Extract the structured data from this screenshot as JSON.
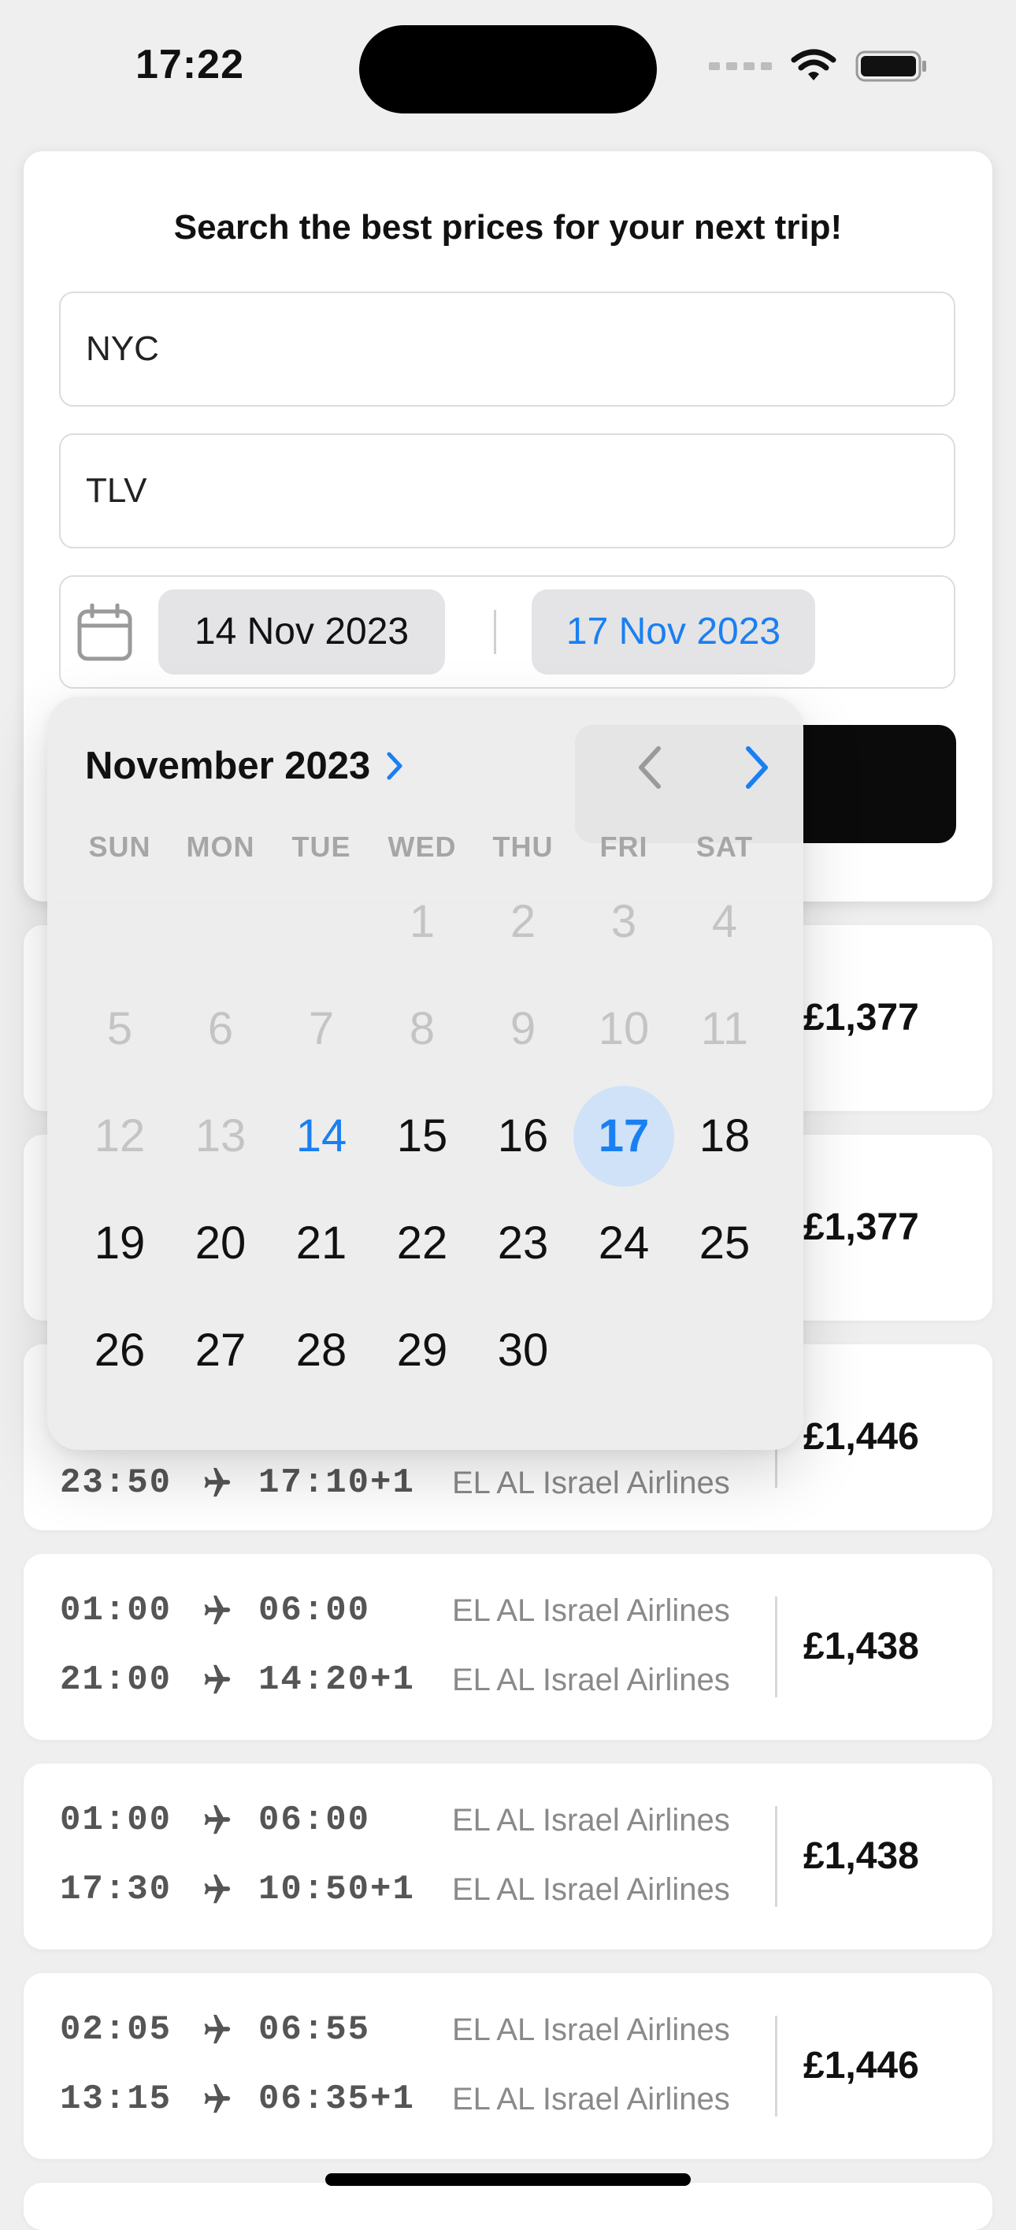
{
  "status_bar": {
    "time": "17:22"
  },
  "search": {
    "headline": "Search the best prices for your next trip!",
    "from_value": "NYC",
    "to_value": "TLV",
    "start_date": "14 Nov 2023",
    "end_date": "17 Nov 2023"
  },
  "calendar": {
    "month_label": "November 2023",
    "weekdays": [
      "SUN",
      "MON",
      "TUE",
      "WED",
      "THU",
      "FRI",
      "SAT"
    ],
    "disabled_days": [
      "1",
      "2",
      "3",
      "4",
      "5",
      "6",
      "7",
      "8",
      "9",
      "10",
      "11",
      "12",
      "13"
    ],
    "start_day": "14",
    "end_day": "17",
    "active_days": [
      "15",
      "16",
      "18",
      "19",
      "20",
      "21",
      "22",
      "23",
      "24",
      "25",
      "26",
      "27",
      "28",
      "29",
      "30"
    ],
    "accent_color": "#1a7ff2",
    "selection_fill": "#cfe2f8"
  },
  "results": [
    {
      "legs": [
        {
          "dep": "",
          "arr": "",
          "airline": ""
        },
        {
          "dep": "",
          "arr": "",
          "airline": ""
        }
      ],
      "price": "£1,377"
    },
    {
      "legs": [
        {
          "dep": "",
          "arr": "",
          "airline": ""
        },
        {
          "dep": "",
          "arr": "",
          "airline": ""
        }
      ],
      "price": "£1,377"
    },
    {
      "legs": [
        {
          "dep": "",
          "arr": "",
          "airline": ""
        },
        {
          "dep": "23:50",
          "arr": "17:10+1",
          "airline": "EL AL Israel Airlines"
        }
      ],
      "price": "£1,446"
    },
    {
      "legs": [
        {
          "dep": "01:00",
          "arr": "06:00",
          "airline": "EL AL Israel Airlines"
        },
        {
          "dep": "21:00",
          "arr": "14:20+1",
          "airline": "EL AL Israel Airlines"
        }
      ],
      "price": "£1,438"
    },
    {
      "legs": [
        {
          "dep": "01:00",
          "arr": "06:00",
          "airline": "EL AL Israel Airlines"
        },
        {
          "dep": "17:30",
          "arr": "10:50+1",
          "airline": "EL AL Israel Airlines"
        }
      ],
      "price": "£1,438"
    },
    {
      "legs": [
        {
          "dep": "02:05",
          "arr": "06:55",
          "airline": "EL AL Israel Airlines"
        },
        {
          "dep": "13:15",
          "arr": "06:35+1",
          "airline": "EL AL Israel Airlines"
        }
      ],
      "price": "£1,446"
    }
  ]
}
